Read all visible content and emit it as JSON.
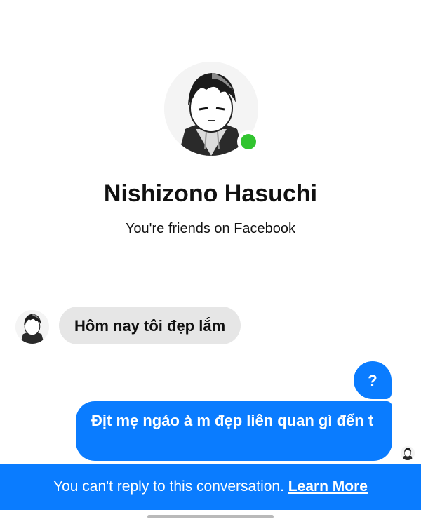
{
  "profile": {
    "name": "Nishizono Hasuchi",
    "subtitle": "You're friends on Facebook",
    "status": "online",
    "avatar_icon": "manga-portrait-avatar"
  },
  "messages": [
    {
      "direction": "incoming",
      "text": "Hôm nay tôi đẹp lắm"
    },
    {
      "direction": "outgoing",
      "text": "?"
    },
    {
      "direction": "outgoing",
      "text": "Địt mẹ ngáo à m đẹp liên quan gì đến t"
    }
  ],
  "banner": {
    "text": "You can't reply to this conversation.",
    "link": "Learn More"
  },
  "colors": {
    "accent": "#0a7cff",
    "incoming_bubble": "#e6e6e6",
    "online": "#31c42f"
  }
}
